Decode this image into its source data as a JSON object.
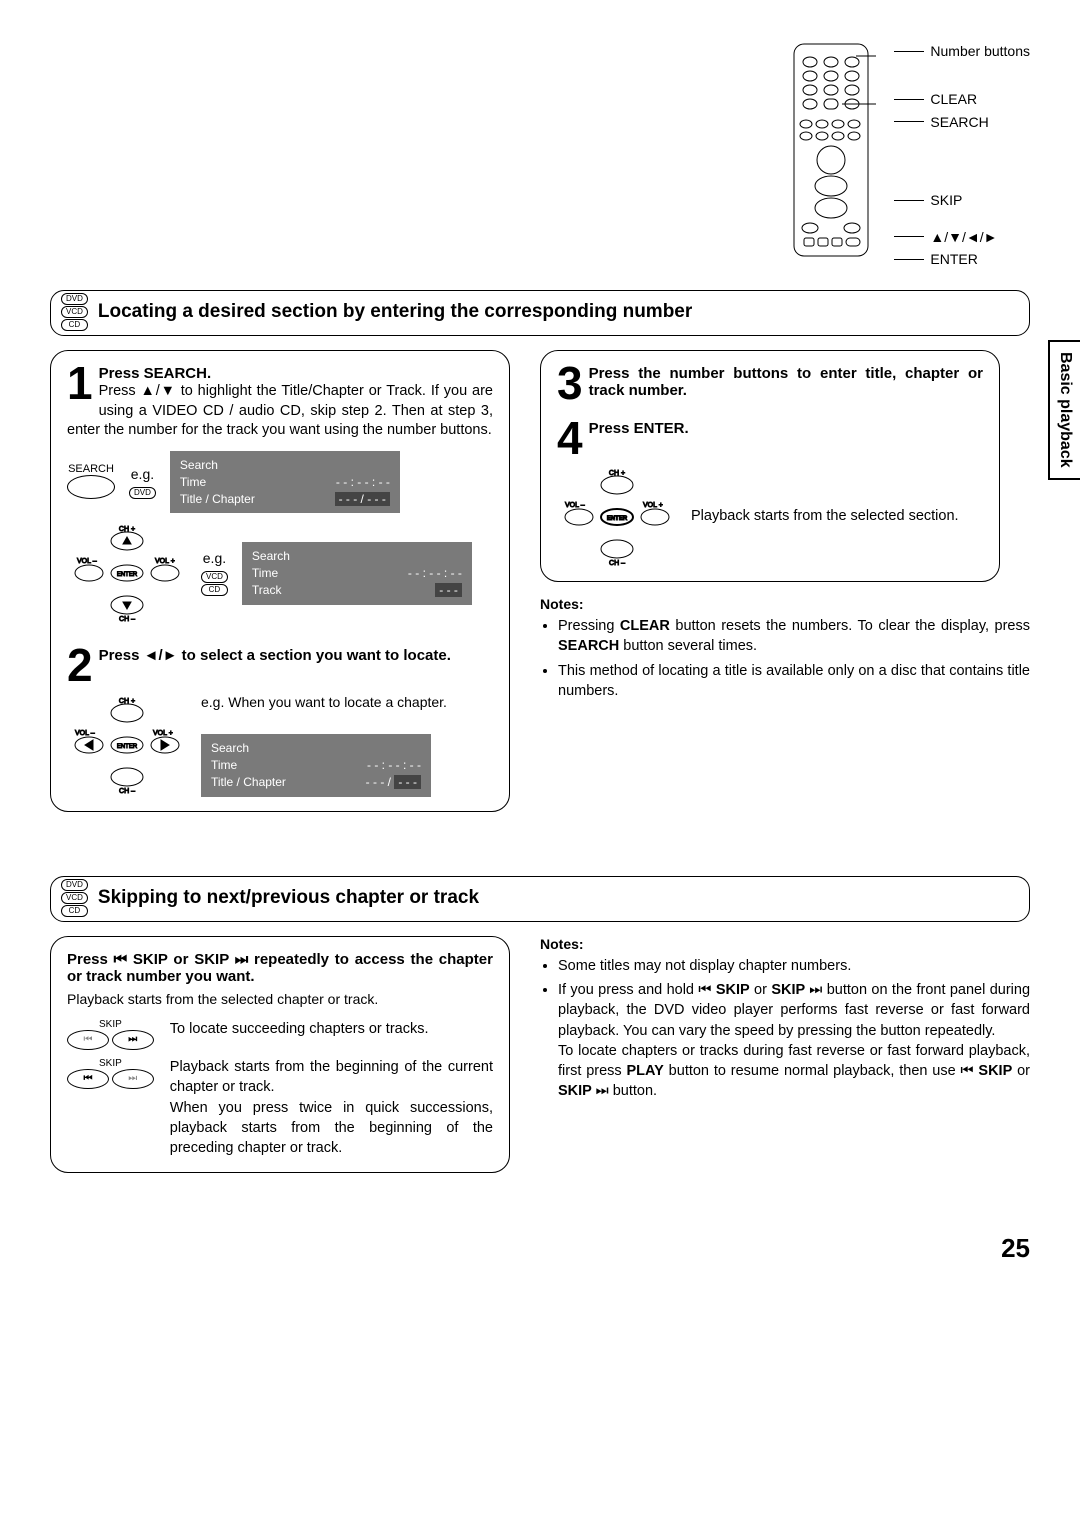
{
  "sideTab": "Basic playback",
  "remoteLabels": {
    "l1": "Number buttons",
    "l2": "CLEAR",
    "l3": "SEARCH",
    "l4": "SKIP",
    "l5": "▲/▼/◄/►",
    "l6": "ENTER"
  },
  "section1": {
    "discs": [
      "DVD",
      "VCD",
      "CD"
    ],
    "title": "Locating a desired section by entering the corresponding number",
    "step1": {
      "num": "1",
      "title": "Press SEARCH.",
      "body": "Press ▲/▼ to highlight the Title/Chapter or Track. If you are using a VIDEO CD / audio CD, skip step 2. Then at step 3, enter the number for the track you want using the number buttons.",
      "searchLabel": "SEARCH",
      "eg": "e.g.",
      "discDVD": "DVD",
      "discVCD": "VCD",
      "discCD": "CD",
      "osd1": {
        "r1": "Search",
        "r2l": "Time",
        "r2r": "- - : - - : - -",
        "r3l": "Title / Chapter",
        "r3r": "- - - / - - -"
      },
      "osd2": {
        "r1": "Search",
        "r2l": "Time",
        "r2r": "- - : - - : - -",
        "r3l": "Track",
        "r3r": "- - -"
      }
    },
    "step2": {
      "num": "2",
      "title": "Press ◄/► to select a section you want to locate.",
      "eg": "e.g. When you want to locate a chapter.",
      "osd": {
        "r1": "Search",
        "r2l": "Time",
        "r2r": "- - : - - : - -",
        "r3l": "Title / Chapter",
        "r3r": "- - - /  - - -"
      }
    },
    "step3": {
      "num": "3",
      "title": "Press the number buttons to enter title, chapter or track number."
    },
    "step4": {
      "num": "4",
      "title": "Press ENTER.",
      "body": "Playback starts from the selected section."
    },
    "notesH": "Notes:",
    "note1a": "Pressing ",
    "note1b": "CLEAR",
    "note1c": " button resets the numbers. To clear the display, press ",
    "note1d": "SEARCH",
    "note1e": " button several times.",
    "note2": "This method of locating a title is available only on a disc that contains title numbers."
  },
  "section2": {
    "discs": [
      "DVD",
      "VCD",
      "CD"
    ],
    "title": "Skipping to next/previous chapter or track",
    "body1a": "Press ",
    "skipPrevIcon": "⏮",
    "body1b": " SKIP or SKIP ",
    "skipNextIcon": "⏭",
    "body1c": " repeatedly to access the chapter or track number you want.",
    "body2": "Playback starts from the selected chapter or track.",
    "skipLabel": "SKIP",
    "col2a": "To locate succeeding chapters or tracks.",
    "col2b": "Playback starts from the beginning of the current chapter or track.",
    "col2c": "When you press twice in quick successions, playback starts from the beginning of the preceding chapter or track.",
    "notesH": "Notes:",
    "n1": "Some titles may not display chapter numbers.",
    "n2a": "If you press and hold ",
    "n2b": " SKIP",
    "n2c": " or ",
    "n2d": "SKIP ",
    "n2e": " button on the front panel during playback, the DVD video player performs fast reverse or fast forward playback. You can vary the speed by pressing the button repeatedly.",
    "n2f": "To locate chapters or tracks during fast reverse or fast forward playback, first press ",
    "n2g": "PLAY",
    "n2h": " button to resume normal playback, then use ",
    "n2i": " SKIP",
    "n2j": " or ",
    "n2k": "SKIP ",
    "n2l": " button."
  },
  "pageNumber": "25",
  "dpad": {
    "chp": "CH +",
    "chm": "CH –",
    "volm": "VOL –",
    "volp": "VOL +",
    "enter": "ENTER"
  }
}
